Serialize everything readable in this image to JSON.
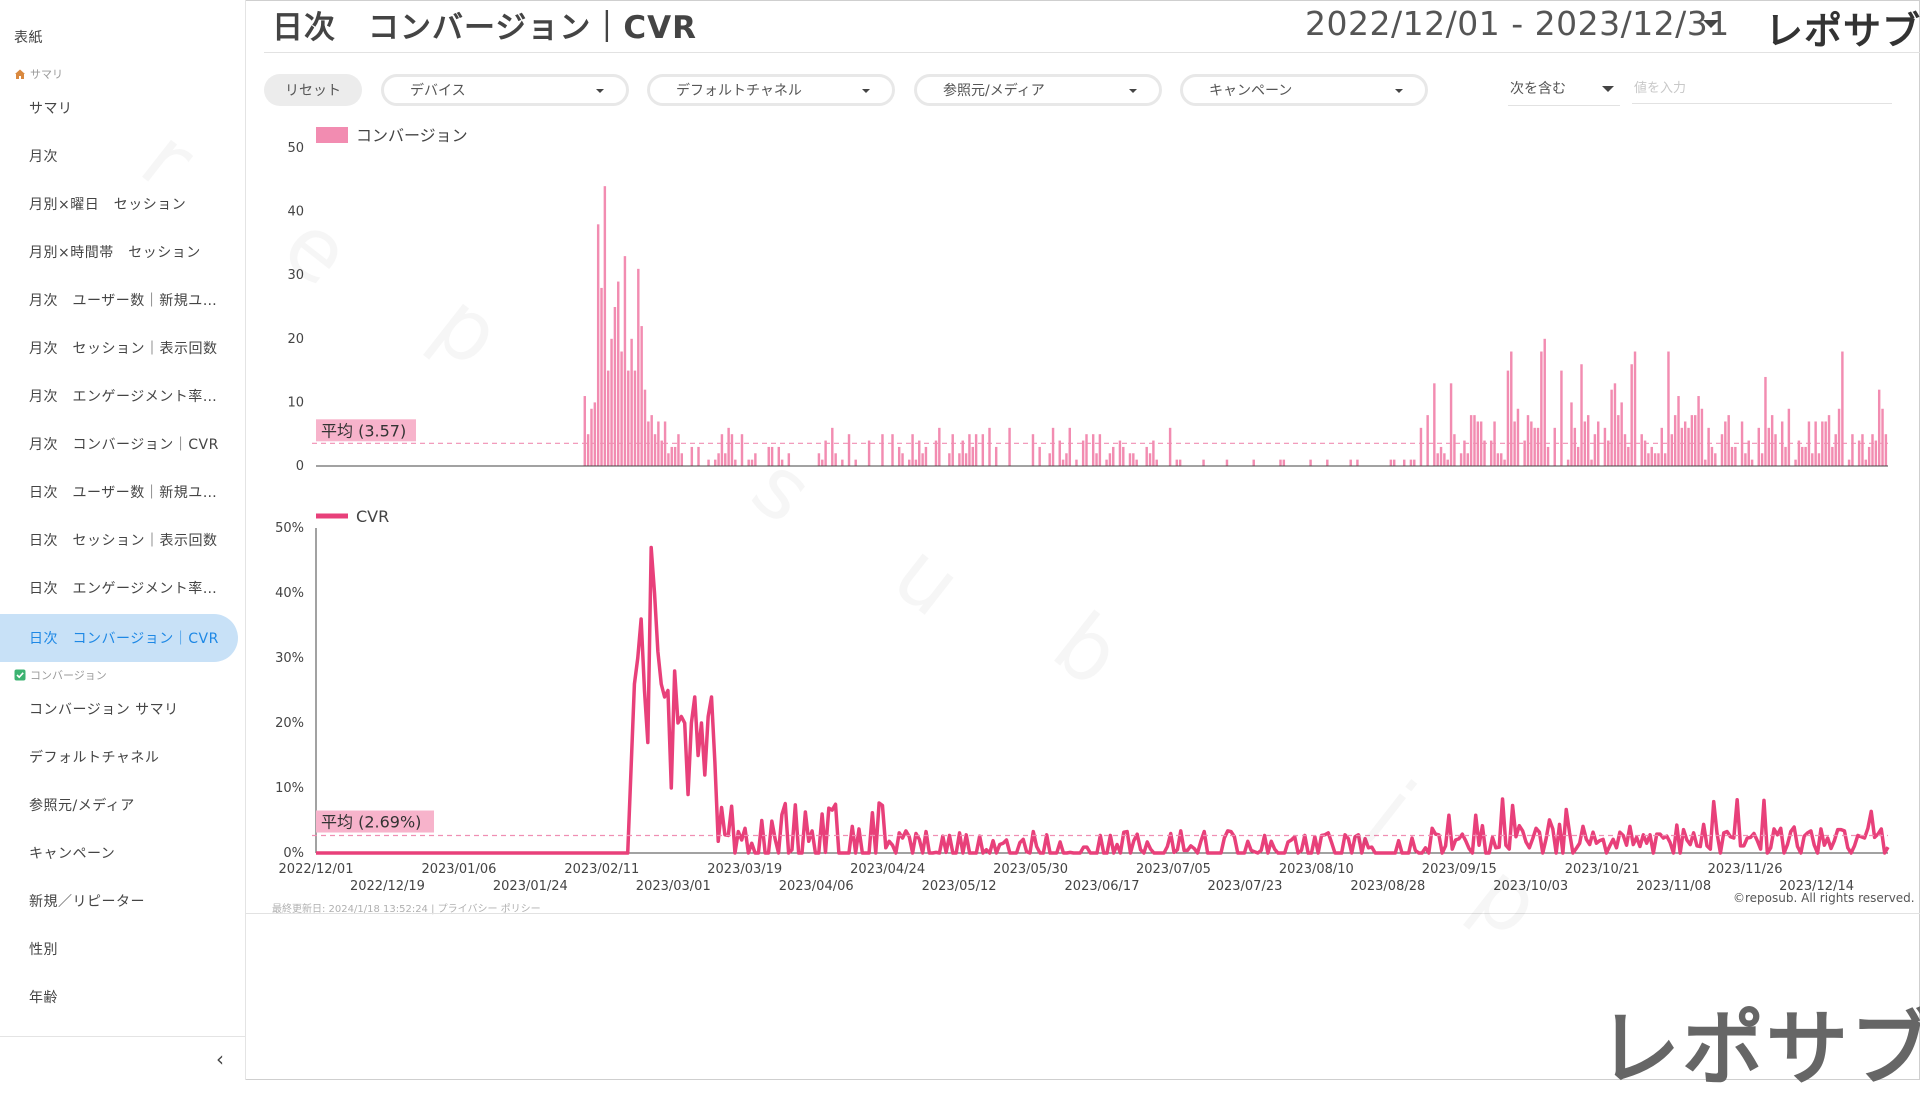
{
  "sidebar": {
    "cover_label": "表紙",
    "summary_section": {
      "label": "サマリ",
      "icon": "house-icon"
    },
    "items": [
      {
        "label": "サマリ"
      },
      {
        "label": "月次"
      },
      {
        "label": "月別×曜日　セッション"
      },
      {
        "label": "月別×時間帯　セッション"
      },
      {
        "label": "月次　ユーザー数｜新規ユ…"
      },
      {
        "label": "月次　セッション｜表示回数"
      },
      {
        "label": "月次　エンゲージメント率…"
      },
      {
        "label": "月次　コンバージョン｜CVR"
      },
      {
        "label": "日次　ユーザー数｜新規ユ…"
      },
      {
        "label": "日次　セッション｜表示回数"
      },
      {
        "label": "日次　エンゲージメント率…"
      },
      {
        "label": "日次　コンバージョン｜CVR",
        "active": true
      }
    ],
    "conversion_section": {
      "label": "コンバージョン",
      "icon": "check-box-icon"
    },
    "conversion_items": [
      {
        "label": "コンバージョン サマリ"
      },
      {
        "label": "デフォルトチャネル"
      },
      {
        "label": "参照元/メディア"
      },
      {
        "label": "キャンペーン"
      },
      {
        "label": "新規／リピーター"
      },
      {
        "label": "性別"
      },
      {
        "label": "年齢"
      }
    ],
    "collapse_glyph": "‹"
  },
  "header": {
    "title": "日次　コンバージョン｜CVR",
    "date_range": "2022/12/01 - 2023/12/31",
    "logo": "レポサブ"
  },
  "filters": {
    "reset_label": "リセット",
    "dropdowns": [
      "デバイス",
      "デフォルトチャネル",
      "参照元/メディア",
      "キャンペーン"
    ],
    "match_mode": "次を含む",
    "value_placeholder": "値を入力"
  },
  "colors": {
    "bar": "#f28cb1",
    "line": "#e8407a",
    "avg_label_bg": "#f7b3cb",
    "avg_line": "#f08fb3",
    "sidebar_active": "#c8e1f7"
  },
  "chart_data": [
    {
      "type": "bar",
      "legend": "コンバージョン",
      "ylim": [
        0,
        50
      ],
      "yticks": [
        "0",
        "10",
        "20",
        "30",
        "40",
        "50"
      ],
      "average": 3.57,
      "average_label": "平均 (3.57)",
      "start_date": "2022/12/01",
      "values": [
        0,
        0,
        0,
        0,
        0,
        0,
        0,
        0,
        0,
        0,
        0,
        0,
        0,
        0,
        0,
        0,
        0,
        0,
        0,
        0,
        0,
        0,
        0,
        0,
        0,
        0,
        0,
        0,
        0,
        0,
        0,
        0,
        0,
        0,
        0,
        0,
        0,
        0,
        0,
        0,
        0,
        0,
        0,
        0,
        0,
        0,
        0,
        0,
        0,
        0,
        0,
        0,
        0,
        0,
        0,
        0,
        0,
        0,
        0,
        0,
        0,
        0,
        0,
        0,
        0,
        0,
        0,
        0,
        0,
        0,
        0,
        0,
        0,
        0,
        0,
        0,
        0,
        0,
        0,
        0,
        0,
        0,
        0,
        0,
        0,
        0,
        0,
        0,
        0,
        0,
        0,
        0,
        0,
        0,
        0,
        0,
        0,
        0,
        0,
        0,
        0,
        0,
        0,
        0,
        0,
        0,
        0,
        0,
        0,
        0,
        0,
        0,
        0,
        0,
        0,
        0,
        0,
        0,
        0,
        0,
        0,
        0,
        0,
        0,
        0,
        0,
        0,
        0,
        0,
        0,
        0,
        0,
        0,
        0,
        0,
        0,
        0,
        0,
        0,
        0,
        0,
        0,
        0,
        0,
        0,
        0,
        0,
        0,
        0,
        0,
        0,
        0,
        0,
        0,
        0,
        0,
        0,
        0,
        0,
        0,
        0,
        0,
        0,
        0,
        0,
        0,
        0,
        0,
        0,
        0,
        0,
        0,
        0,
        0,
        0,
        0,
        0,
        0,
        0,
        0,
        0,
        0,
        0,
        0,
        0,
        0,
        0,
        0,
        0,
        0,
        0,
        0,
        0,
        0,
        0,
        0,
        0,
        0,
        0,
        0,
        0,
        0,
        0,
        0,
        0,
        0,
        0,
        0,
        0,
        0,
        0,
        0,
        0,
        0,
        0,
        0,
        0,
        0,
        0,
        0,
        0,
        0,
        0,
        0,
        0,
        0,
        0,
        0,
        0,
        0,
        0,
        0,
        0,
        0,
        0,
        0,
        0,
        0,
        0,
        0,
        0,
        0,
        0,
        0,
        0,
        0,
        0,
        0,
        0,
        0,
        0,
        0,
        0,
        0,
        0,
        0,
        0,
        0,
        0,
        0,
        0,
        0,
        0,
        0,
        0,
        0,
        0,
        0,
        0,
        0,
        0,
        0,
        0,
        0,
        0,
        0,
        0,
        0,
        0,
        0,
        0,
        0,
        0,
        0,
        0,
        0,
        0,
        0,
        0,
        0,
        0,
        0,
        0,
        0,
        0,
        0,
        0,
        0,
        0,
        0,
        0,
        0,
        0,
        0,
        0,
        0,
        0,
        0,
        0,
        0,
        0,
        0,
        0,
        0,
        0,
        0,
        0,
        0,
        0,
        0,
        0,
        0,
        0,
        0,
        0,
        0,
        0,
        0,
        0,
        0,
        0,
        0,
        0,
        0,
        0,
        0,
        0,
        0,
        0,
        0,
        0,
        0,
        0,
        0,
        0,
        0,
        0,
        0,
        0,
        0,
        0,
        0,
        0,
        0,
        0,
        0,
        0,
        0,
        0,
        0,
        0,
        0,
        0,
        0,
        0,
        0,
        0,
        0,
        0,
        0,
        0,
        0,
        0,
        0,
        0,
        0,
        0,
        0,
        0,
        0,
        0,
        0,
        0,
        0,
        0,
        0,
        0,
        0,
        0,
        0,
        0,
        0,
        0,
        0,
        0,
        0,
        0,
        0,
        0,
        0,
        0,
        0,
        0,
        0,
        0,
        0,
        0,
        0,
        0,
        0,
        0,
        0,
        0,
        0,
        0,
        0,
        0,
        0,
        0,
        0,
        0,
        0,
        0,
        0,
        0,
        0,
        0,
        0,
        0,
        0,
        0,
        0,
        0,
        0,
        0,
        0,
        0,
        0,
        0,
        0,
        0,
        0,
        0,
        0,
        0,
        0,
        0,
        0,
        0,
        0,
        0,
        0,
        0,
        0,
        0,
        0,
        0,
        0,
        0,
        0,
        0,
        0,
        0,
        0,
        0,
        0,
        0,
        0,
        0,
        0
      ]
    },
    {
      "type": "line",
      "legend": "CVR",
      "ylim": [
        0,
        50
      ],
      "yticks": [
        "0%",
        "10%",
        "20%",
        "30%",
        "40%",
        "50%"
      ],
      "average": 2.69,
      "average_label": "平均 (2.69%)",
      "start_date": "2022/12/01",
      "values": [],
      "xticks_upper": [
        "2022/12/01",
        "2023/01/06",
        "2023/02/11",
        "2023/03/19",
        "2023/04/24",
        "2023/05/30",
        "2023/07/05",
        "2023/08/10",
        "2023/09/15",
        "2023/10/21",
        "2023/11/26"
      ],
      "xticks_lower": [
        "2022/12/19",
        "2023/01/24",
        "2023/03/01",
        "2023/04/06",
        "2023/05/12",
        "2023/06/17",
        "2023/07/23",
        "2023/08/28",
        "2023/10/03",
        "2023/11/08",
        "2023/12/14"
      ]
    }
  ],
  "footer": {
    "updated": "最終更新日: 2024/1/18 13:52:24",
    "separator": "|",
    "privacy": "プライバシー ポリシー",
    "copyright": "©reposub. All rights reserved.",
    "big_logo": "レポサブ"
  }
}
